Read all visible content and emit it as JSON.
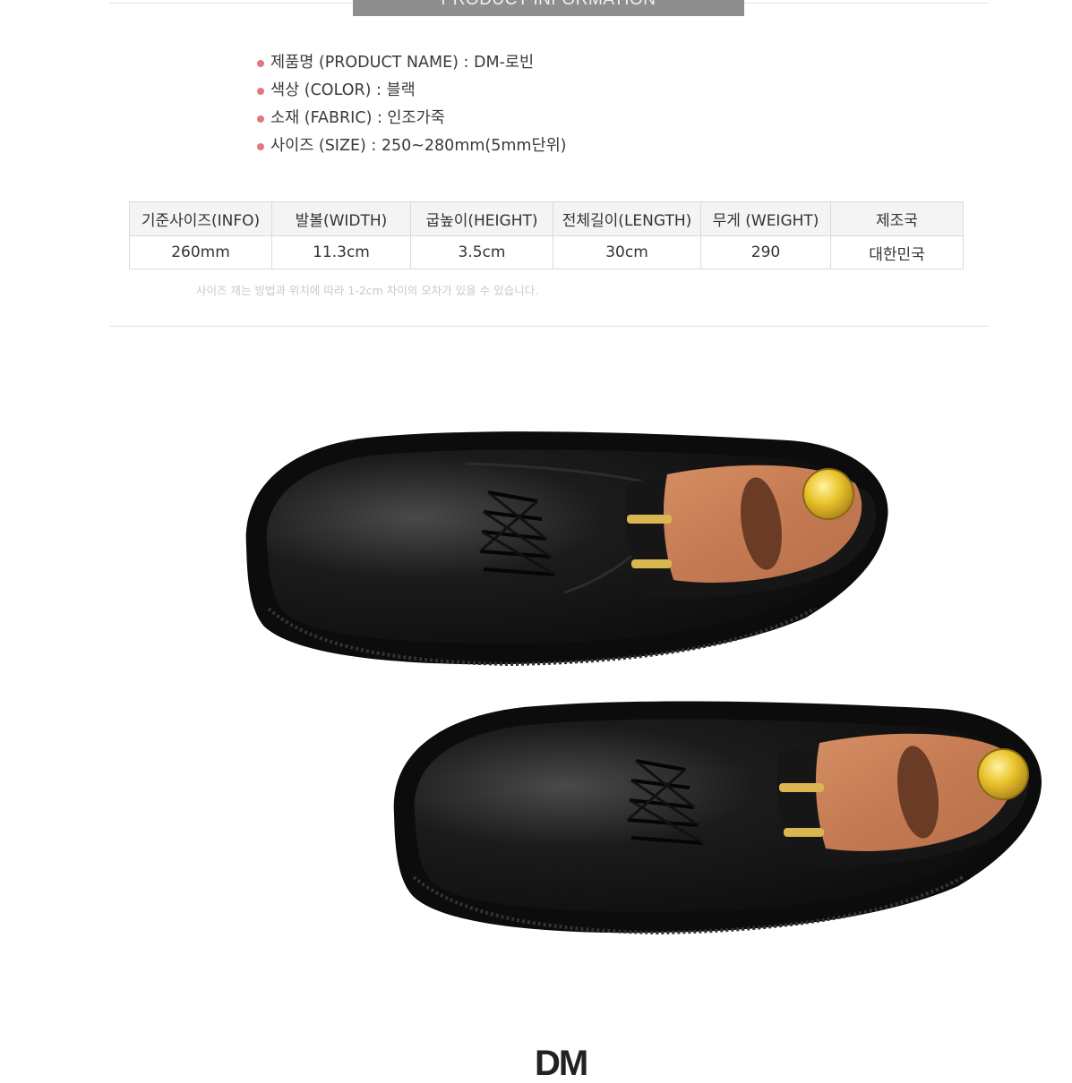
{
  "header": {
    "banner": "PRODUCT INFORMATION"
  },
  "specs": [
    {
      "text": "제품명 (PRODUCT NAME) :  DM-로빈"
    },
    {
      "text": "색상 (COLOR) : 블랙"
    },
    {
      "text": "소재 (FABRIC) : 인조가죽"
    },
    {
      "text": "사이즈 (SIZE) : 250~280mm(5mm단위)"
    }
  ],
  "size_table": {
    "headers": [
      "기준사이즈(INFO)",
      "발볼(WIDTH)",
      "굽높이(HEIGHT)",
      "전체길이(LENGTH)",
      "무게 (WEIGHT)",
      "제조국"
    ],
    "row": [
      "260mm",
      "11.3cm",
      "3.5cm",
      "30cm",
      "290",
      "대한민국"
    ]
  },
  "note": "사이즈 재는 방법과 위치에 따라 1-2cm 차이의 오차가 있을 수 있습니다.",
  "product_image": {
    "description_icon": "shoe-photo",
    "brand_on_plate": ""
  },
  "footer": {
    "logo": "DM"
  },
  "colors": {
    "banner_bg": "#8e8e8e",
    "bullet": "#e2787f",
    "table_header_bg": "#f4f4f4"
  }
}
